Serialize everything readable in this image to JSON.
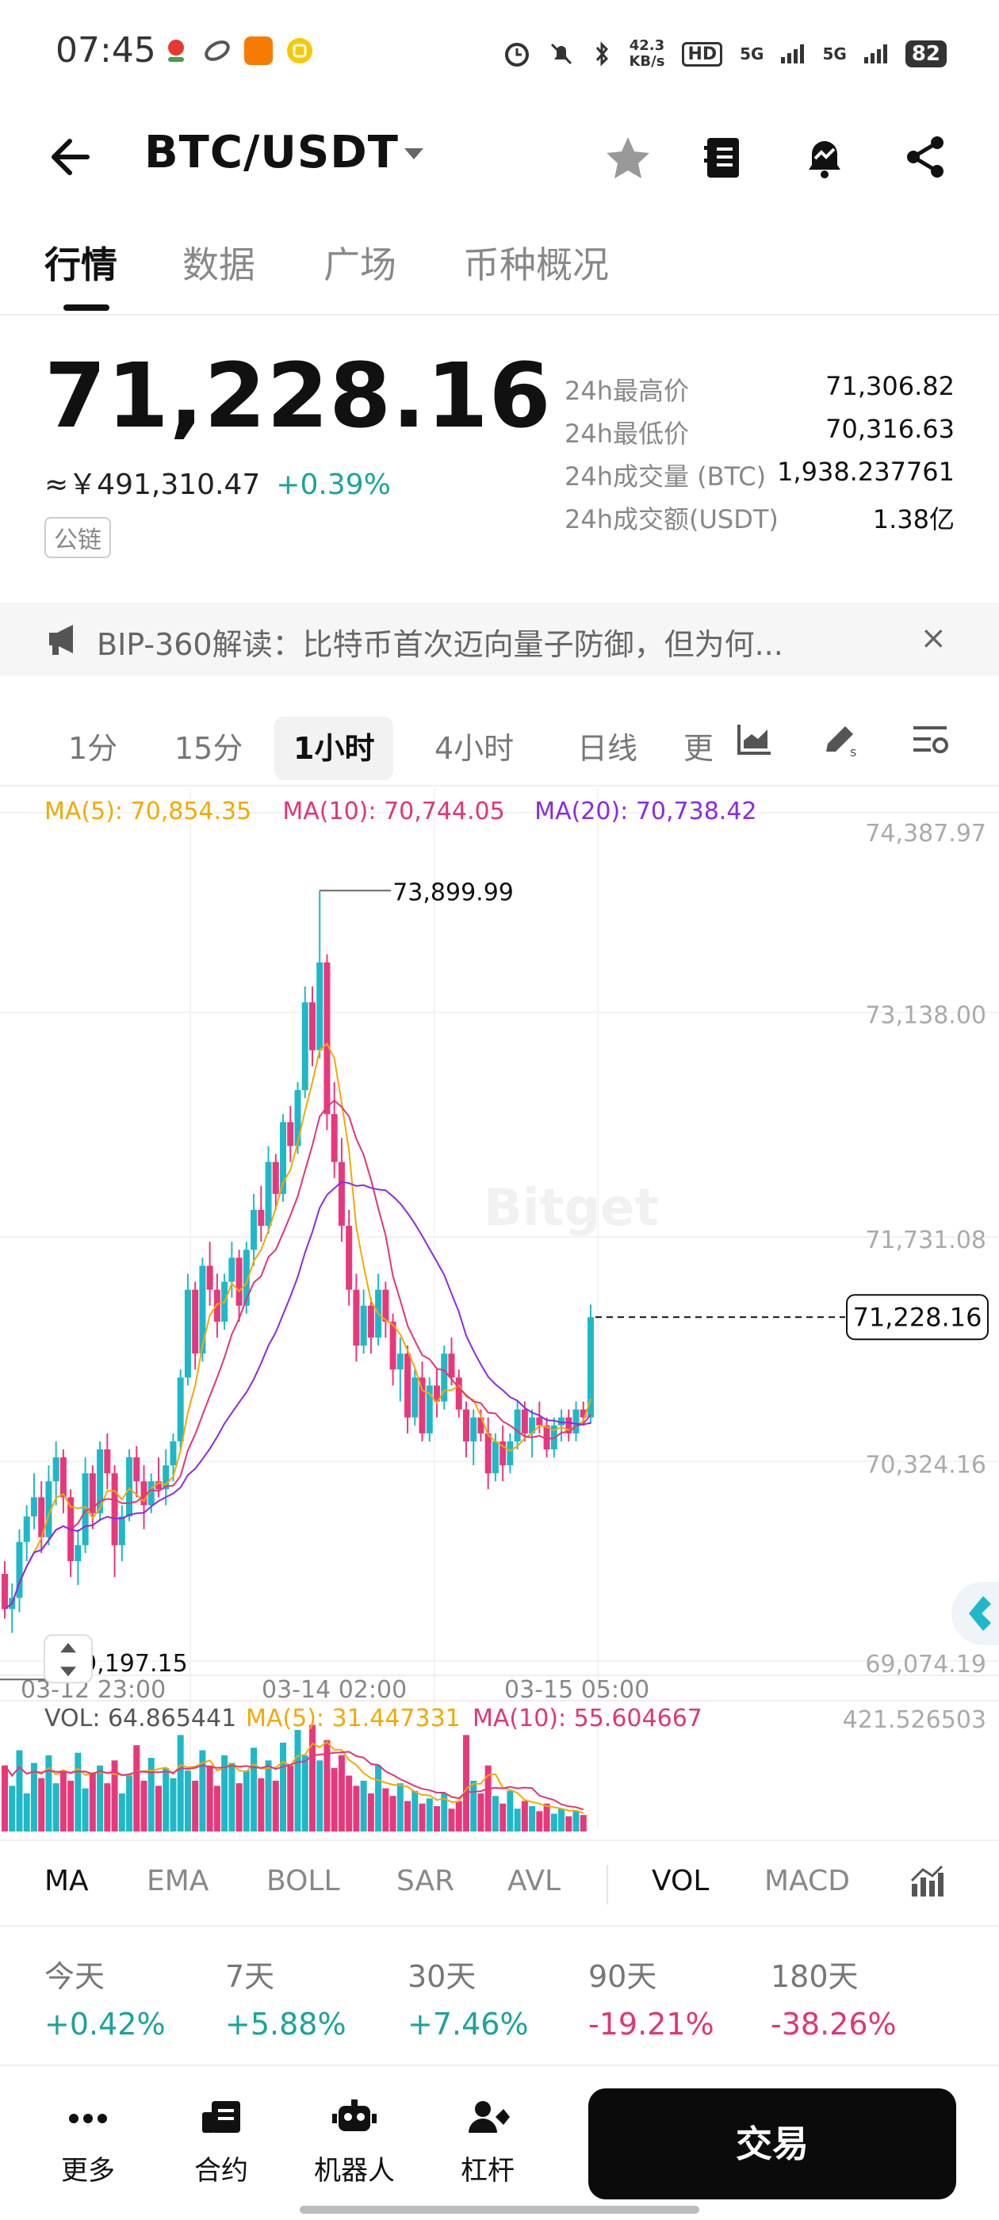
{
  "status_bar": {
    "time": "07:45",
    "net_speed_value": "42.3",
    "net_speed_unit": "KB/s",
    "hd": "HD",
    "signal1": "5G",
    "signal2": "5G",
    "battery": "82"
  },
  "header": {
    "pair": "BTC/USDT"
  },
  "tabs": [
    "行情",
    "数据",
    "广场",
    "币种概况"
  ],
  "price": {
    "last": "71,228.16",
    "cny": "≈￥491,310.47",
    "change": "+0.39%",
    "chain_tag": "公链"
  },
  "stats": [
    {
      "label": "24h最高价",
      "value": "71,306.82"
    },
    {
      "label": "24h最低价",
      "value": "70,316.63"
    },
    {
      "label": "24h成交量 (BTC)",
      "value": "1,938.237761"
    },
    {
      "label": "24h成交额(USDT)",
      "value": "1.38亿"
    }
  ],
  "notice": {
    "text": "BIP-360解读：比特币首次迈向量子防御，但为何...",
    "close": "×"
  },
  "intervals": [
    "1分",
    "15分",
    "1小时",
    "4小时",
    "日线",
    "更"
  ],
  "chart_data": {
    "type": "candlestick",
    "ma_legend": [
      {
        "label": "MA(5): 70,854.35",
        "color": "#f2a900"
      },
      {
        "label": "MA(10): 70,744.05",
        "color": "#e0357a"
      },
      {
        "label": "MA(20): 70,738.42",
        "color": "#8a2be2"
      }
    ],
    "y_ticks": [
      "74,387.97",
      "73,138.00",
      "71,731.08",
      "70,324.16",
      "69,074.19"
    ],
    "y_tick_values": [
      74387.97,
      73138.0,
      71731.08,
      70324.16,
      69074.19
    ],
    "ylim": [
      69074.19,
      74387.97
    ],
    "x_ticks": [
      "03-12 23:00",
      "03-14 02:00",
      "03-15 05:00"
    ],
    "high_label": "73,899.99",
    "high_value": 73899.99,
    "low_label": "69,197.15",
    "low_value": 69197.15,
    "current_price_label": "71,228.16",
    "current_price": 71228.16,
    "watermark": "Bitget",
    "up_color": "#1fb8c8",
    "down_color": "#e8387c",
    "candles": [
      [
        69620,
        69700,
        69340,
        69400
      ],
      [
        69400,
        69560,
        69250,
        69470
      ],
      [
        69470,
        69900,
        69380,
        69820
      ],
      [
        69820,
        70050,
        69700,
        69980
      ],
      [
        69980,
        70250,
        69900,
        70100
      ],
      [
        70100,
        70200,
        69750,
        69850
      ],
      [
        69850,
        70300,
        69800,
        70200
      ],
      [
        70200,
        70450,
        70050,
        70350
      ],
      [
        70350,
        70400,
        70000,
        70100
      ],
      [
        70100,
        70150,
        69600,
        69700
      ],
      [
        69700,
        69900,
        69550,
        69800
      ],
      [
        69800,
        70350,
        69750,
        70250
      ],
      [
        70250,
        70300,
        69900,
        70000
      ],
      [
        70000,
        70450,
        69950,
        70400
      ],
      [
        70400,
        70500,
        70150,
        70250
      ],
      [
        70250,
        70300,
        69600,
        69800
      ],
      [
        69800,
        70050,
        69700,
        69980
      ],
      [
        69980,
        70400,
        69950,
        70350
      ],
      [
        70350,
        70420,
        70100,
        70200
      ],
      [
        70200,
        70300,
        69900,
        70050
      ],
      [
        70050,
        70250,
        70000,
        70200
      ],
      [
        70200,
        70350,
        70100,
        70150
      ],
      [
        70150,
        70400,
        70050,
        70300
      ],
      [
        70300,
        70500,
        70200,
        70450
      ],
      [
        70450,
        70900,
        70400,
        70850
      ],
      [
        70850,
        71500,
        70800,
        71400
      ],
      [
        71400,
        71450,
        70900,
        71000
      ],
      [
        71000,
        71600,
        70950,
        71550
      ],
      [
        71550,
        71700,
        71300,
        71400
      ],
      [
        71400,
        71500,
        71100,
        71200
      ],
      [
        71200,
        71500,
        71150,
        71450
      ],
      [
        71450,
        71700,
        71350,
        71600
      ],
      [
        71600,
        71650,
        71200,
        71300
      ],
      [
        71300,
        71700,
        71250,
        71650
      ],
      [
        71650,
        72000,
        71550,
        71900
      ],
      [
        71900,
        72050,
        71700,
        71800
      ],
      [
        71800,
        72300,
        71750,
        72200
      ],
      [
        72200,
        72250,
        71900,
        72000
      ],
      [
        72000,
        72500,
        71950,
        72450
      ],
      [
        72450,
        72550,
        72200,
        72300
      ],
      [
        72300,
        72700,
        72250,
        72650
      ],
      [
        72650,
        73300,
        72600,
        73200
      ],
      [
        73200,
        73300,
        72800,
        72900
      ],
      [
        72900,
        73899.99,
        72850,
        73450
      ],
      [
        73450,
        73500,
        72400,
        72500
      ],
      [
        72500,
        72700,
        72100,
        72200
      ],
      [
        72200,
        72350,
        71700,
        71800
      ],
      [
        71800,
        71900,
        71300,
        71400
      ],
      [
        71400,
        71500,
        70950,
        71050
      ],
      [
        71050,
        71400,
        71000,
        71300
      ],
      [
        71300,
        71350,
        71000,
        71100
      ],
      [
        71100,
        71500,
        71050,
        71400
      ],
      [
        71400,
        71450,
        71100,
        71200
      ],
      [
        71200,
        71250,
        70800,
        70900
      ],
      [
        70900,
        71100,
        70700,
        71000
      ],
      [
        71000,
        71050,
        70500,
        70600
      ],
      [
        70600,
        70900,
        70550,
        70850
      ],
      [
        70850,
        70950,
        70450,
        70500
      ],
      [
        70500,
        70850,
        70450,
        70800
      ],
      [
        70800,
        70900,
        70600,
        70700
      ],
      [
        70700,
        71050,
        70650,
        71000
      ],
      [
        71000,
        71100,
        70800,
        70850
      ],
      [
        70850,
        70900,
        70600,
        70650
      ],
      [
        70650,
        70700,
        70350,
        70450
      ],
      [
        70450,
        70650,
        70300,
        70600
      ],
      [
        70600,
        70650,
        70450,
        70500
      ],
      [
        70500,
        70600,
        70150,
        70250
      ],
      [
        70250,
        70500,
        70200,
        70450
      ],
      [
        70450,
        70550,
        70200,
        70300
      ],
      [
        70300,
        70500,
        70250,
        70450
      ],
      [
        70450,
        70700,
        70400,
        70650
      ],
      [
        70650,
        70700,
        70450,
        70500
      ],
      [
        70500,
        70650,
        70350,
        70600
      ],
      [
        70600,
        70700,
        70500,
        70550
      ],
      [
        70550,
        70600,
        70350,
        70400
      ],
      [
        70400,
        70600,
        70350,
        70550
      ],
      [
        70550,
        70650,
        70450,
        70600
      ],
      [
        70600,
        70650,
        70450,
        70500
      ],
      [
        70500,
        70700,
        70450,
        70650
      ],
      [
        70650,
        70700,
        70550,
        70600
      ],
      [
        70600,
        71306.82,
        70560,
        71228.16
      ]
    ]
  },
  "volume": {
    "vol_label": "VOL: 64.865441",
    "ma5_label": "MA(5): 31.447331",
    "ma10_label": "MA(10): 55.604667",
    "max_tick": "421.526503",
    "max_value": 421.526503,
    "values": [
      260,
      180,
      320,
      150,
      270,
      210,
      300,
      190,
      240,
      200,
      310,
      170,
      230,
      260,
      190,
      280,
      150,
      220,
      340,
      200,
      290,
      180,
      250,
      210,
      380,
      240,
      200,
      320,
      260,
      180,
      300,
      270,
      190,
      240,
      330,
      210,
      280,
      200,
      350,
      260,
      400,
      300,
      420,
      280,
      360,
      250,
      300,
      220,
      180,
      200,
      150,
      260,
      170,
      140,
      190,
      120,
      160,
      110,
      130,
      100,
      150,
      90,
      120,
      380,
      200,
      150,
      260,
      140,
      110,
      160,
      90,
      120,
      100,
      80,
      110,
      70,
      90,
      60,
      80,
      65
    ]
  },
  "indicators": [
    "MA",
    "EMA",
    "BOLL",
    "SAR",
    "AVL",
    "VOL",
    "MACD"
  ],
  "performance": [
    {
      "period": "今天",
      "value": "+0.42%",
      "dir": "up"
    },
    {
      "period": "7天",
      "value": "+5.88%",
      "dir": "up"
    },
    {
      "period": "30天",
      "value": "+7.46%",
      "dir": "up"
    },
    {
      "period": "90天",
      "value": "-19.21%",
      "dir": "down"
    },
    {
      "period": "180天",
      "value": "-38.26%",
      "dir": "down"
    }
  ],
  "bottom_nav": {
    "more": "更多",
    "contract": "合约",
    "robot": "机器人",
    "margin": "杠杆",
    "trade": "交易"
  }
}
